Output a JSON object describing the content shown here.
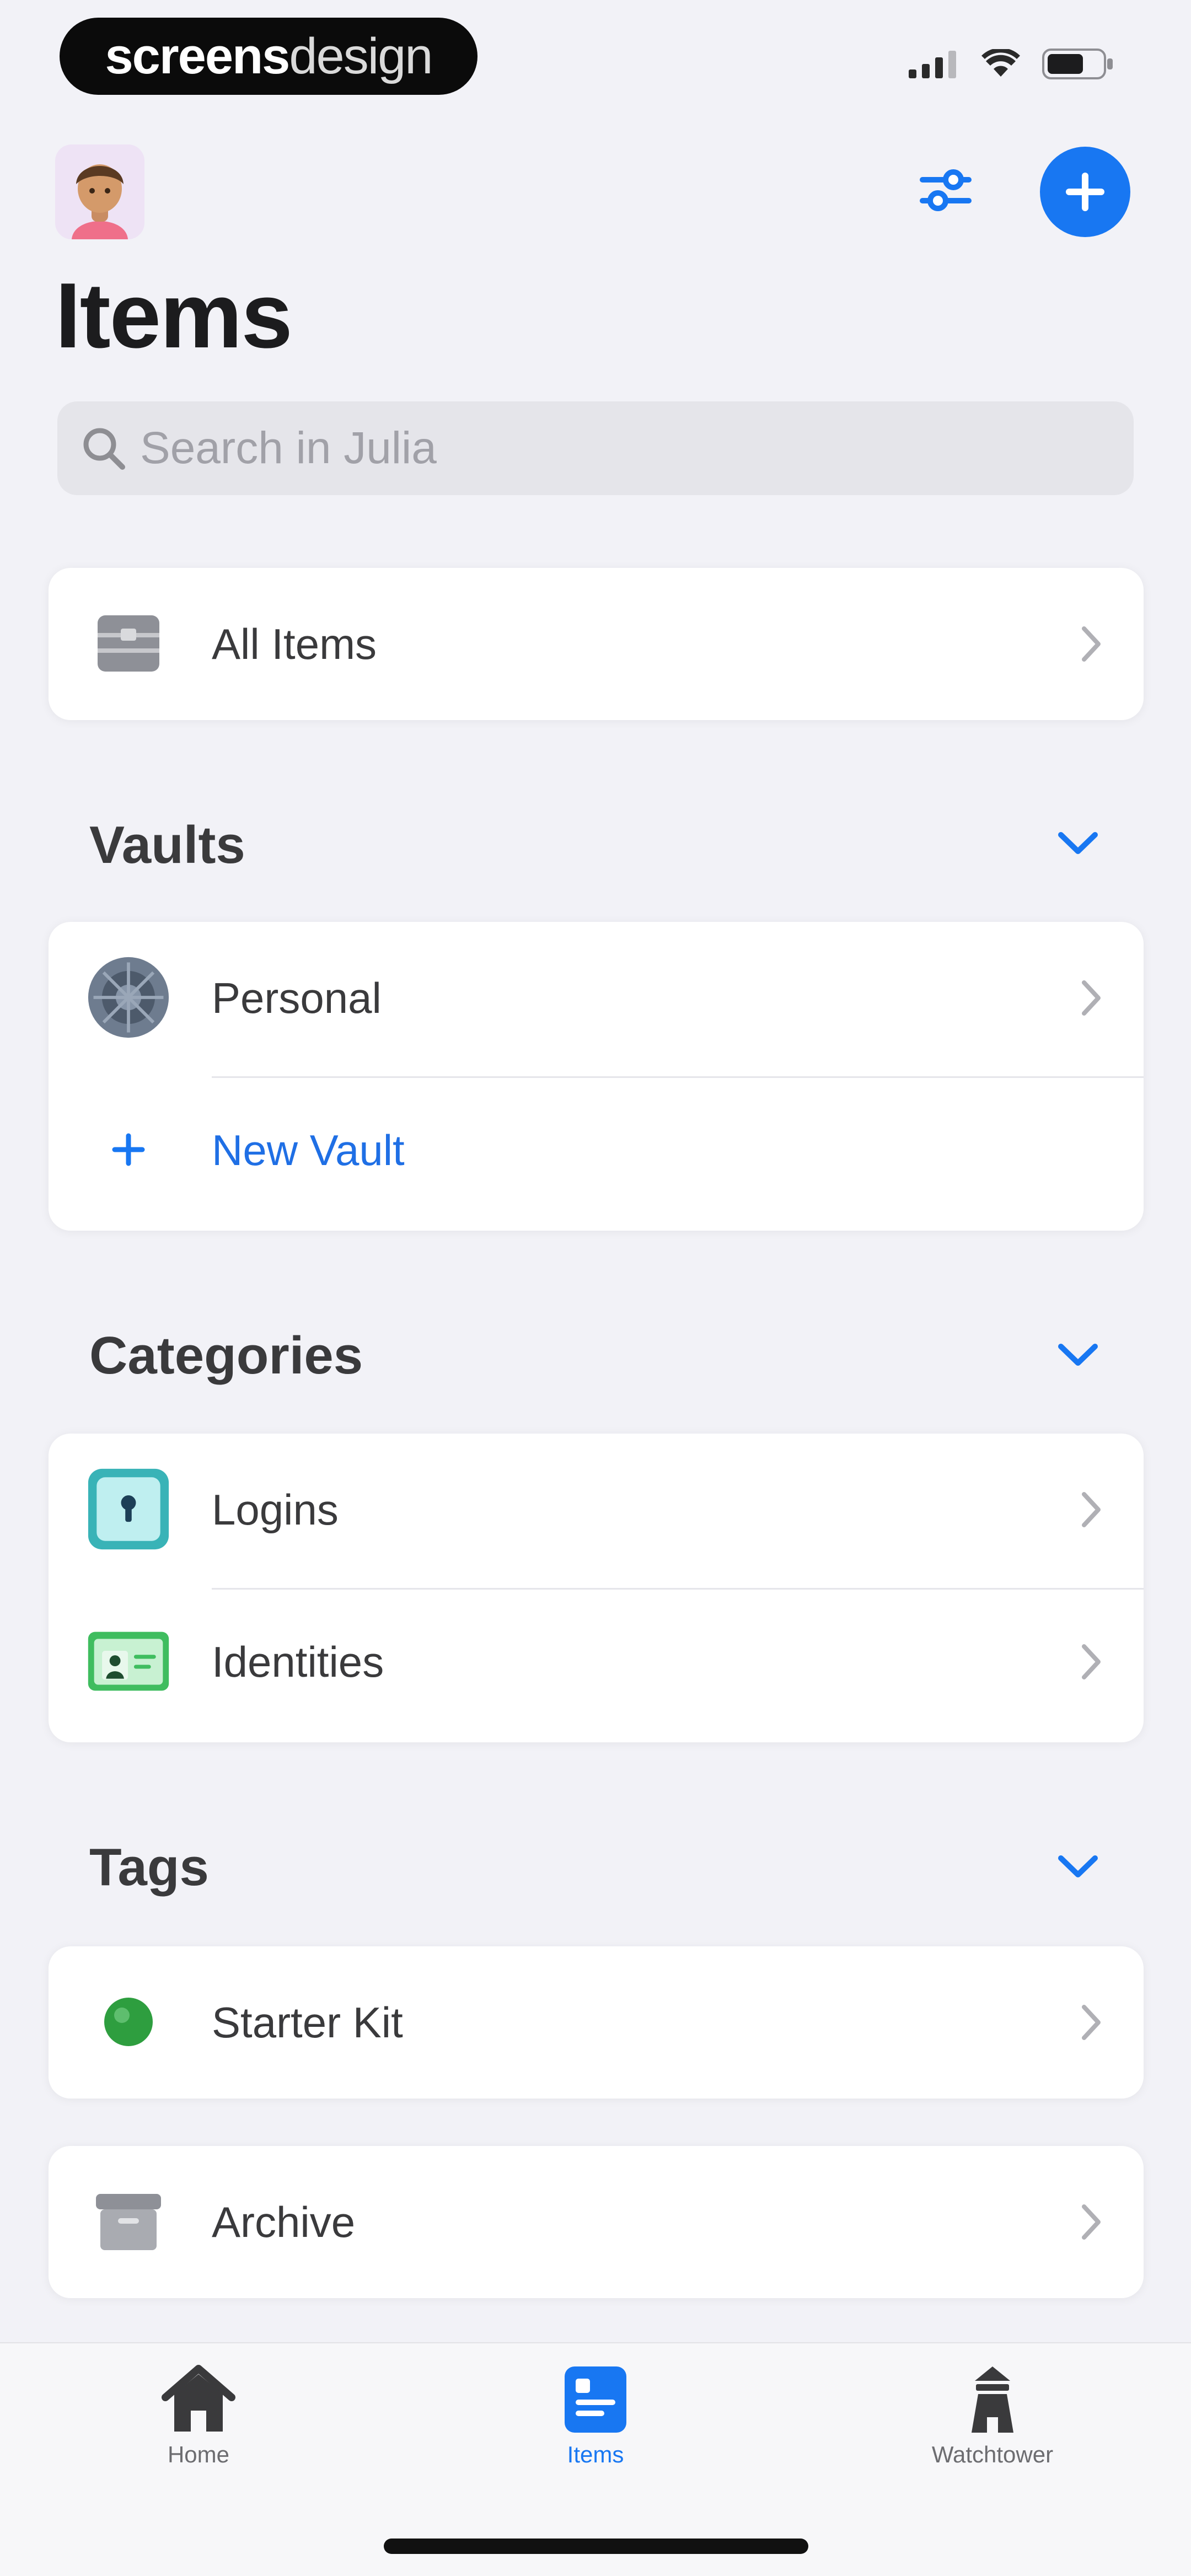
{
  "status_bar": {
    "brand_part1": "screens",
    "brand_part2": "design"
  },
  "header": {
    "title": "Items",
    "avatar_icon": "avatar-memoji",
    "filter_icon": "sliders-icon",
    "add_icon": "plus-icon"
  },
  "search": {
    "placeholder": "Search in Julia"
  },
  "all_items": {
    "label": "All Items"
  },
  "vaults": {
    "title": "Vaults",
    "items": [
      {
        "label": "Personal"
      },
      {
        "label": "New Vault"
      }
    ]
  },
  "categories": {
    "title": "Categories",
    "items": [
      {
        "label": "Logins"
      },
      {
        "label": "Identities"
      }
    ]
  },
  "tags": {
    "title": "Tags",
    "items": [
      {
        "label": "Starter Kit"
      }
    ]
  },
  "archive": {
    "label": "Archive"
  },
  "tab_bar": {
    "tabs": [
      {
        "label": "Home",
        "active": false
      },
      {
        "label": "Items",
        "active": true
      },
      {
        "label": "Watchtower",
        "active": false
      }
    ]
  },
  "colors": {
    "accent": "#1877f2",
    "background": "#f2f2f7",
    "tag_green": "#2e9e3f"
  }
}
